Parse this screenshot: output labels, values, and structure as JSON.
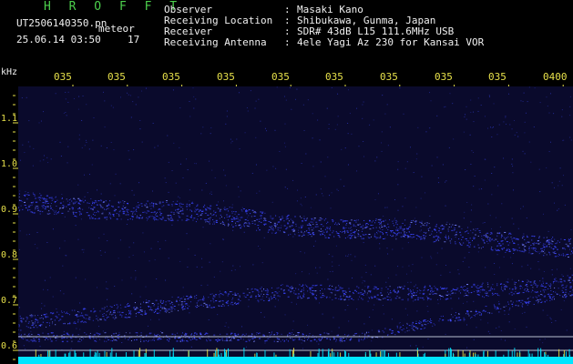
{
  "title": "H R O F F T",
  "file_name": "UT2506140350.pn",
  "meteor_label": "meteor",
  "timestamp": "25.06.14 03:50",
  "meteor_count": "17",
  "header": [
    {
      "label": "Observer",
      "sep": ":",
      "value": "Masaki Kano"
    },
    {
      "label": "Receiving Location",
      "sep": ":",
      "value": "Shibukawa, Gunma, Japan"
    },
    {
      "label": "Receiver",
      "sep": ":",
      "value": "SDR# 43dB L15 111.6MHz USB"
    },
    {
      "label": "Receiving Antenna",
      "sep": ":",
      "value": "4ele Yagi Az 230 for Kansai VOR"
    }
  ],
  "y_unit": "kHz",
  "y_ticks": [
    "1.1",
    "1.0",
    "0.9",
    "0.8",
    "0.7",
    "0.6"
  ],
  "x_ticks": [
    "035",
    "035",
    "035",
    "035",
    "035",
    "035",
    "035",
    "035",
    "035",
    "0400"
  ],
  "colors": {
    "background": "#000000",
    "plot_bg": "#0a0a2c",
    "signal": "#3b46ff",
    "noise_floor": "#00e5ff",
    "tick": "#e6e04a",
    "label_green": "#4ccf4c"
  }
}
